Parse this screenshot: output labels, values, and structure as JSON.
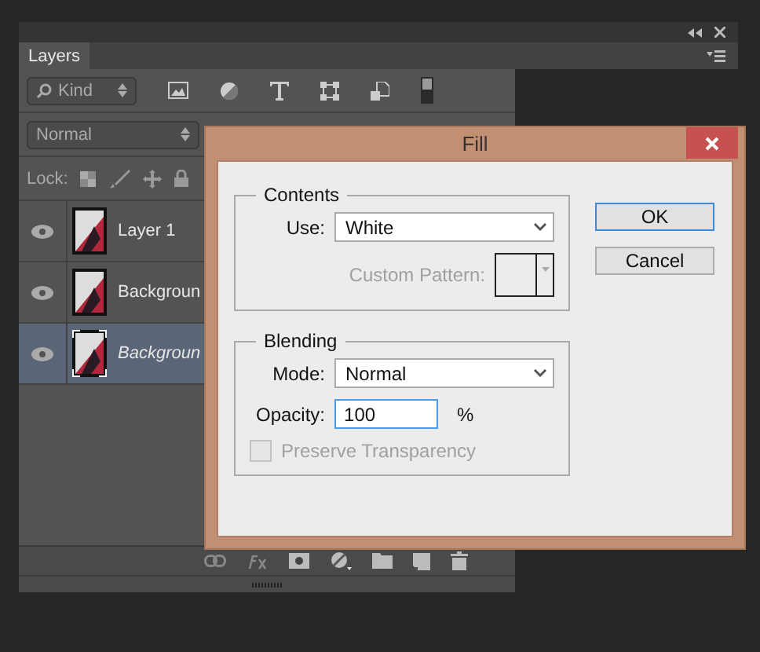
{
  "panel": {
    "tab": "Layers",
    "filter": "Kind",
    "blend_mode": "Normal",
    "lock_label": "Lock:"
  },
  "layers": [
    {
      "name": "Layer 1",
      "selected": false,
      "visible": true
    },
    {
      "name": "Backgroun",
      "selected": false,
      "visible": true
    },
    {
      "name": "Backgroun",
      "selected": true,
      "visible": true
    }
  ],
  "dialog": {
    "title": "Fill",
    "contents": {
      "legend": "Contents",
      "use_label": "Use:",
      "use_value": "White",
      "pattern_label": "Custom Pattern:",
      "pattern_disabled": true
    },
    "blending": {
      "legend": "Blending",
      "mode_label": "Mode:",
      "mode_value": "Normal",
      "opacity_label": "Opacity:",
      "opacity_value": "100",
      "opacity_unit": "%",
      "preserve": {
        "label": "Preserve Transparency",
        "checked": false,
        "disabled": true
      }
    },
    "buttons": [
      {
        "label": "OK",
        "default": true
      },
      {
        "label": "Cancel",
        "default": false
      }
    ]
  }
}
